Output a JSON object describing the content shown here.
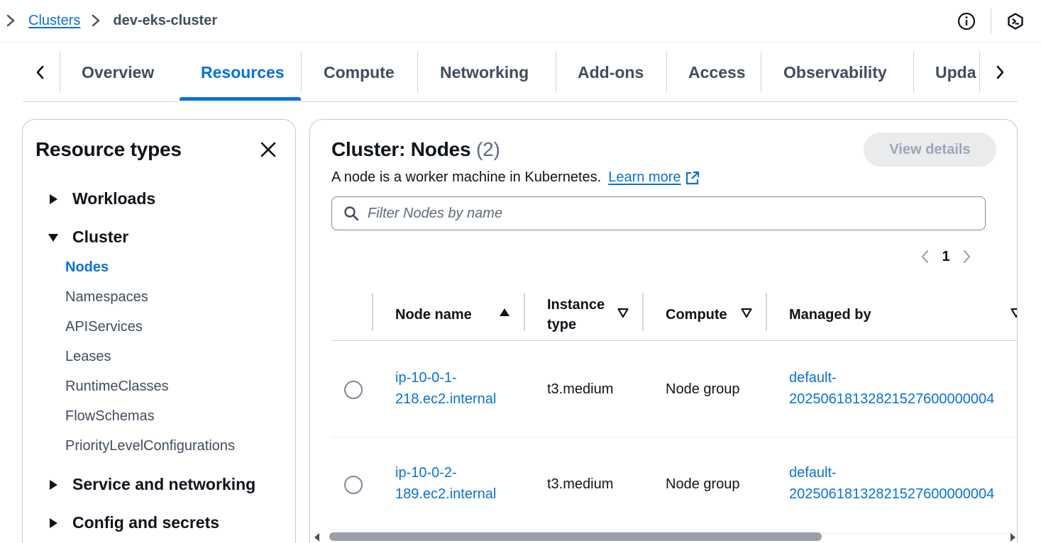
{
  "breadcrumb": {
    "parent": "Clusters",
    "current": "dev-eks-cluster"
  },
  "header_icons": [
    "info-icon",
    "cloudshell-icon"
  ],
  "tabs": [
    {
      "label": "Overview"
    },
    {
      "label": "Resources",
      "active": true
    },
    {
      "label": "Compute"
    },
    {
      "label": "Networking"
    },
    {
      "label": "Add-ons"
    },
    {
      "label": "Access"
    },
    {
      "label": "Observability"
    },
    {
      "label": "Upda"
    }
  ],
  "side_panel": {
    "title": "Resource types",
    "sections": {
      "workloads": "Workloads",
      "cluster": "Cluster",
      "service_networking": "Service and networking",
      "config_secrets": "Config and secrets"
    },
    "cluster_items": [
      "Nodes",
      "Namespaces",
      "APIServices",
      "Leases",
      "RuntimeClasses",
      "FlowSchemas",
      "PriorityLevelConfigurations"
    ],
    "active_item": "Nodes"
  },
  "main": {
    "title": "Cluster: Nodes",
    "count": "(2)",
    "description": "A node is a worker machine in Kubernetes.",
    "learn_more": "Learn more",
    "view_details": "View details",
    "filter_placeholder": "Filter Nodes by name",
    "page": "1"
  },
  "table": {
    "columns": {
      "node_name": "Node name",
      "instance_type_1": "Instance",
      "instance_type_2": "type",
      "compute": "Compute",
      "managed_by": "Managed by"
    },
    "rows": [
      {
        "name_1": "ip-10-0-1-",
        "name_2": "218.ec2.internal",
        "instance_type": "t3.medium",
        "compute": "Node group",
        "managed_1": "default-",
        "managed_2": "20250618132821527600000004"
      },
      {
        "name_1": "ip-10-0-2-",
        "name_2": "189.ec2.internal",
        "instance_type": "t3.medium",
        "compute": "Node group",
        "managed_1": "default-",
        "managed_2": "20250618132821527600000004"
      }
    ]
  },
  "colors": {
    "link": "#0972d3",
    "text": "#0f141a",
    "muted": "#414d5c",
    "border": "#c6c6cd"
  }
}
